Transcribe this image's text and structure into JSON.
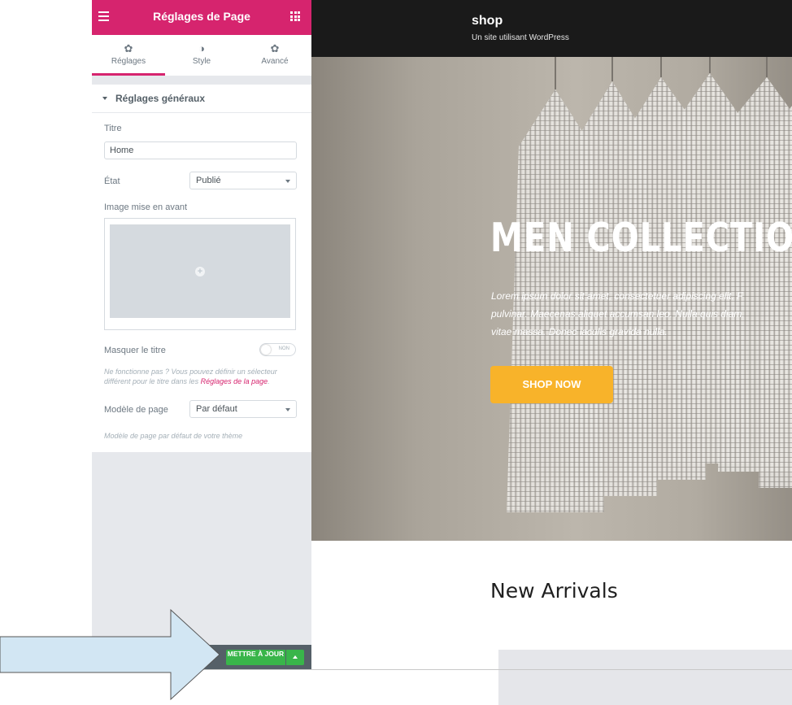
{
  "panel": {
    "title": "Réglages de Page",
    "tabs": [
      {
        "label": "Réglages",
        "icon": "gear-icon"
      },
      {
        "label": "Style",
        "icon": "contrast-icon"
      },
      {
        "label": "Avancé",
        "icon": "gear-icon"
      }
    ],
    "section_title": "Réglages généraux",
    "fields": {
      "title_label": "Titre",
      "title_value": "Home",
      "state_label": "État",
      "state_value": "Publié",
      "featured_image_label": "Image mise en avant",
      "hide_title_label": "Masquer le titre",
      "hide_title_toggle": "NON",
      "hide_title_note": "Ne fonctionne pas ? Vous pouvez définir un sélecteur différent pour le titre dans les ",
      "hide_title_note_link": "Réglages de la page",
      "hide_title_note_end": ".",
      "template_label": "Modèle de page",
      "template_value": "Par défaut",
      "template_note": "Modèle de page par défaut de votre thème"
    },
    "update_button": "METTRE À JOUR"
  },
  "site": {
    "title": "shop",
    "description": "Un site utilisant WordPress"
  },
  "hero": {
    "title": "MEN COLLECTION",
    "text_lines": [
      "Lorem ipsum dolor sit amet, consectetuer adipiscing elit. F",
      "pulvinar. Maecenas aliquet accumsan leo. Nulla quis diam.",
      "vitae massa. Donec iaculis gravida nulla."
    ],
    "button": "SHOP NOW"
  },
  "arrivals_heading": "New Arrivals",
  "colors": {
    "accent": "#d6246e",
    "update_green": "#39b54a",
    "shop_button": "#f8b32a",
    "annotation_arrow": "#d2e6f3"
  }
}
